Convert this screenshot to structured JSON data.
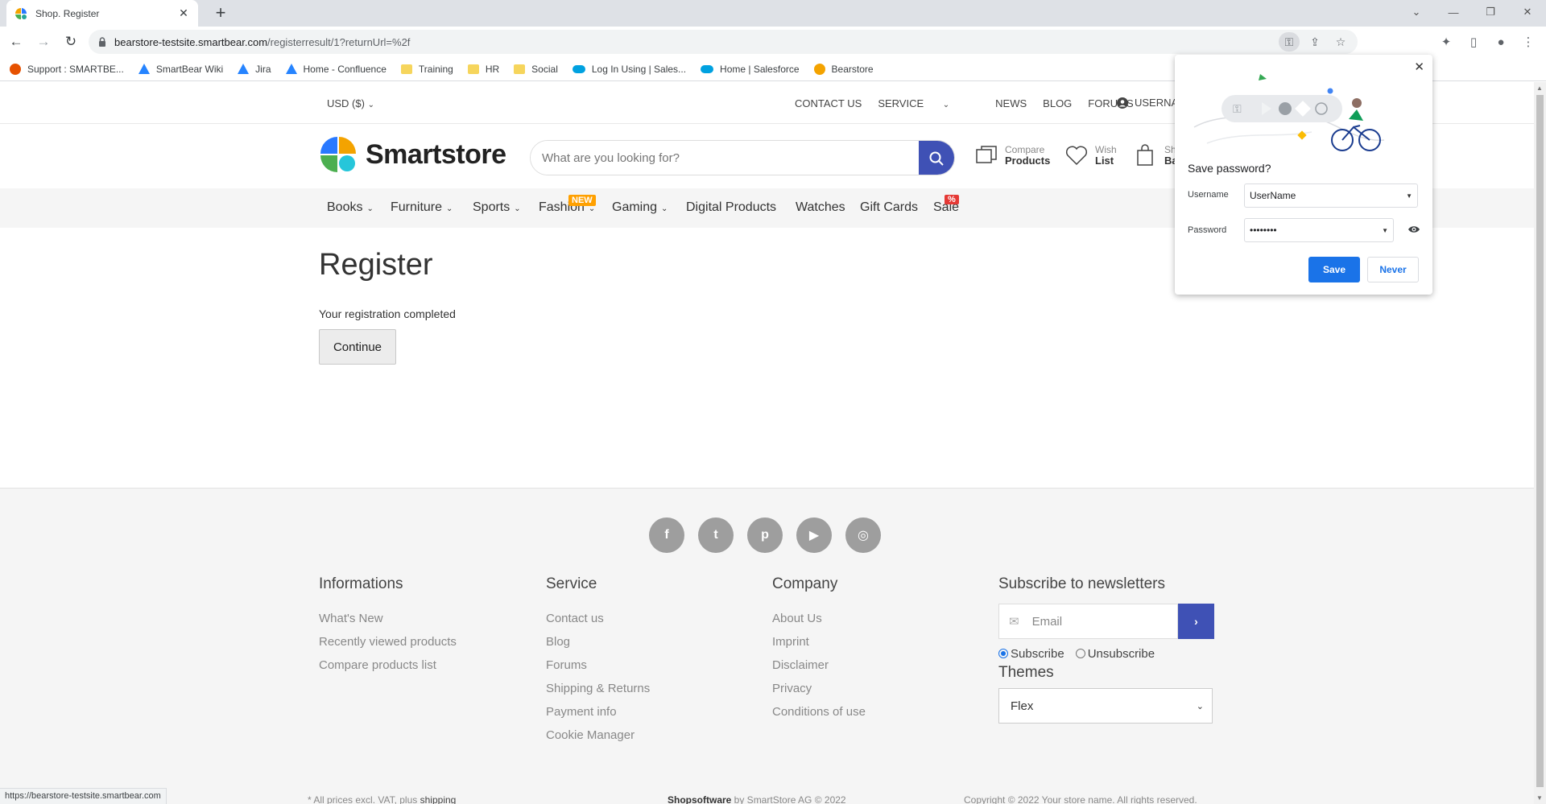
{
  "browser": {
    "tab_title": "Shop. Register",
    "tab_close_icon": "close-icon",
    "new_tab_symbol": "+",
    "url_host": "bearstore-testsite.smartbear.com",
    "url_path": "/registerresult/1?returnUrl=%2f",
    "status_url": "https://bearstore-testsite.smartbear.com",
    "bookmarks": [
      {
        "label": "Support : SMARTBE...",
        "icon": "confluence-icon",
        "color": "#e65100"
      },
      {
        "label": "SmartBear Wiki",
        "icon": "atlassian-icon",
        "color": "#2684ff"
      },
      {
        "label": "Jira",
        "icon": "atlassian-icon",
        "color": "#2684ff"
      },
      {
        "label": "Home - Confluence",
        "icon": "atlassian-icon",
        "color": "#2684ff"
      },
      {
        "label": "Training",
        "icon": "folder-icon",
        "color": "#f6d55c"
      },
      {
        "label": "HR",
        "icon": "folder-icon",
        "color": "#f6d55c"
      },
      {
        "label": "Social",
        "icon": "folder-icon",
        "color": "#f6d55c"
      },
      {
        "label": "Log In Using | Sales...",
        "icon": "salesforce-icon",
        "color": "#00a1e0"
      },
      {
        "label": "Home | Salesforce",
        "icon": "salesforce-icon",
        "color": "#00a1e0"
      },
      {
        "label": "Bearstore",
        "icon": "smartstore-icon",
        "color": "#f4a300"
      }
    ]
  },
  "store": {
    "currency": "USD  ($)",
    "top_links": {
      "contact": "CONTACT US",
      "service": "SERVICE",
      "news": "NEWS",
      "blog": "BLOG",
      "forums": "FORUMS",
      "user": "USERNA"
    },
    "logo_text": "Smartstore",
    "search_placeholder": "What are you looking for?",
    "compare": {
      "top": "Compare",
      "bottom": "Products"
    },
    "wishlist": {
      "top": "Wish",
      "bottom": "List"
    },
    "basket": {
      "top": "Sh",
      "bottom": "Ba"
    },
    "categories": [
      "Books",
      "Furniture",
      "Sports",
      "Fashion",
      "Gaming",
      "Digital Products",
      "Watches",
      "Gift Cards",
      "Sale"
    ],
    "badge_new": "NEW",
    "badge_sale": "%",
    "accent_color": "#3f51b5"
  },
  "content": {
    "title": "Register",
    "message": "Your registration completed",
    "continue_label": "Continue"
  },
  "footer": {
    "socials": [
      "facebook-icon",
      "twitter-icon",
      "pinterest-icon",
      "youtube-icon",
      "instagram-icon"
    ],
    "informations": {
      "title": "Informations",
      "links": [
        "What's New",
        "Recently viewed products",
        "Compare products list"
      ]
    },
    "service": {
      "title": "Service",
      "links": [
        "Contact us",
        "Blog",
        "Forums",
        "Shipping & Returns",
        "Payment info",
        "Cookie Manager"
      ]
    },
    "company": {
      "title": "Company",
      "links": [
        "About Us",
        "Imprint",
        "Disclaimer",
        "Privacy",
        "Conditions of use"
      ]
    },
    "newsletter": {
      "title": "Subscribe to newsletters",
      "email_placeholder": "Email",
      "subscribe": "Subscribe",
      "unsubscribe": "Unsubscribe"
    },
    "themes": {
      "title": "Themes",
      "selected": "Flex"
    },
    "bottom": {
      "prices_note": "* All prices excl. VAT, plus",
      "shipping": "shipping",
      "brand": "Shopsoftware",
      "brand_suffix": " by SmartStore AG © 2022",
      "copyright": "Copyright © 2022 Your store name. All rights reserved."
    }
  },
  "password_popup": {
    "title": "Save password?",
    "username_label": "Username",
    "username_value": "UserName",
    "password_label": "Password",
    "password_value": "••••••••",
    "save_label": "Save",
    "never_label": "Never"
  }
}
